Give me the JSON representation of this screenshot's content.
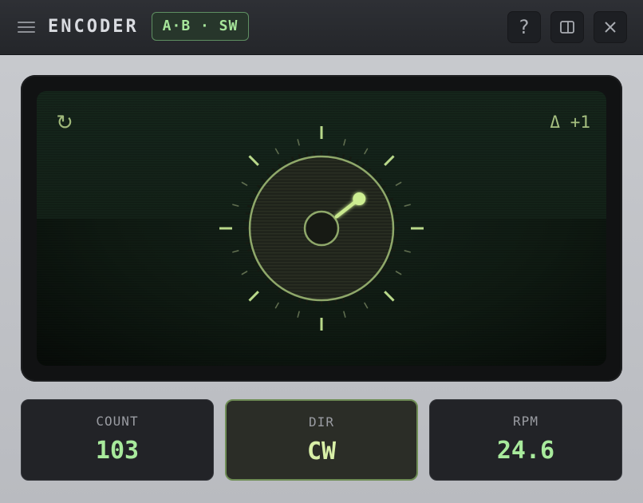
{
  "app": {
    "title": "ENCODER",
    "badge": "A·B · SW"
  },
  "toolbar": {
    "menu_icon": "hamburger-menu-icon",
    "help_label": "?",
    "split_icon": "split-view-icon",
    "close_icon": "close-icon"
  },
  "display": {
    "reset_glyph": "↻",
    "delta_label": "Δ +1",
    "knob": {
      "angle_deg": 52,
      "major_ticks": 8,
      "minor_ticks": 24
    }
  },
  "readouts": [
    {
      "label": "COUNT",
      "value": "103",
      "active": false
    },
    {
      "label": "DIR",
      "value": "CW",
      "active": true
    },
    {
      "label": "RPM",
      "value": "24.6",
      "active": false
    }
  ],
  "colors": {
    "accent": "#a6e59a",
    "phosphor": "#b9d98a",
    "active_border": "#6f8d56"
  }
}
